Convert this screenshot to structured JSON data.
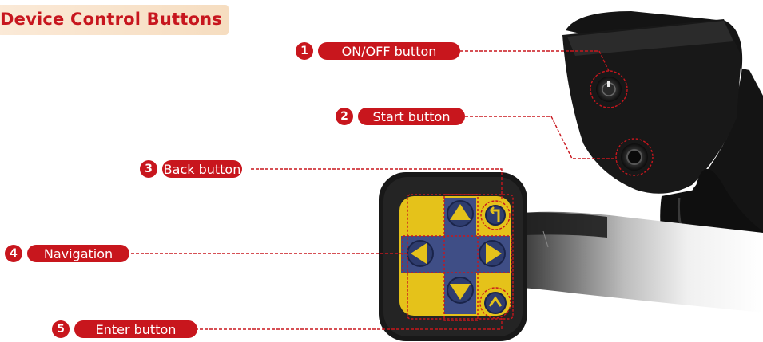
{
  "title": "Device Control Buttons",
  "callouts": [
    {
      "num": "1",
      "label": "ON/OFF button"
    },
    {
      "num": "2",
      "label": "Start button"
    },
    {
      "num": "3",
      "label": "Back button"
    },
    {
      "num": "4",
      "label": "Navigation"
    },
    {
      "num": "5",
      "label": "Enter button"
    }
  ],
  "colors": {
    "accent": "#c8161d",
    "keypad": "#e5c21a",
    "nav": "#3f4e86",
    "body": "#1b1b1b"
  }
}
